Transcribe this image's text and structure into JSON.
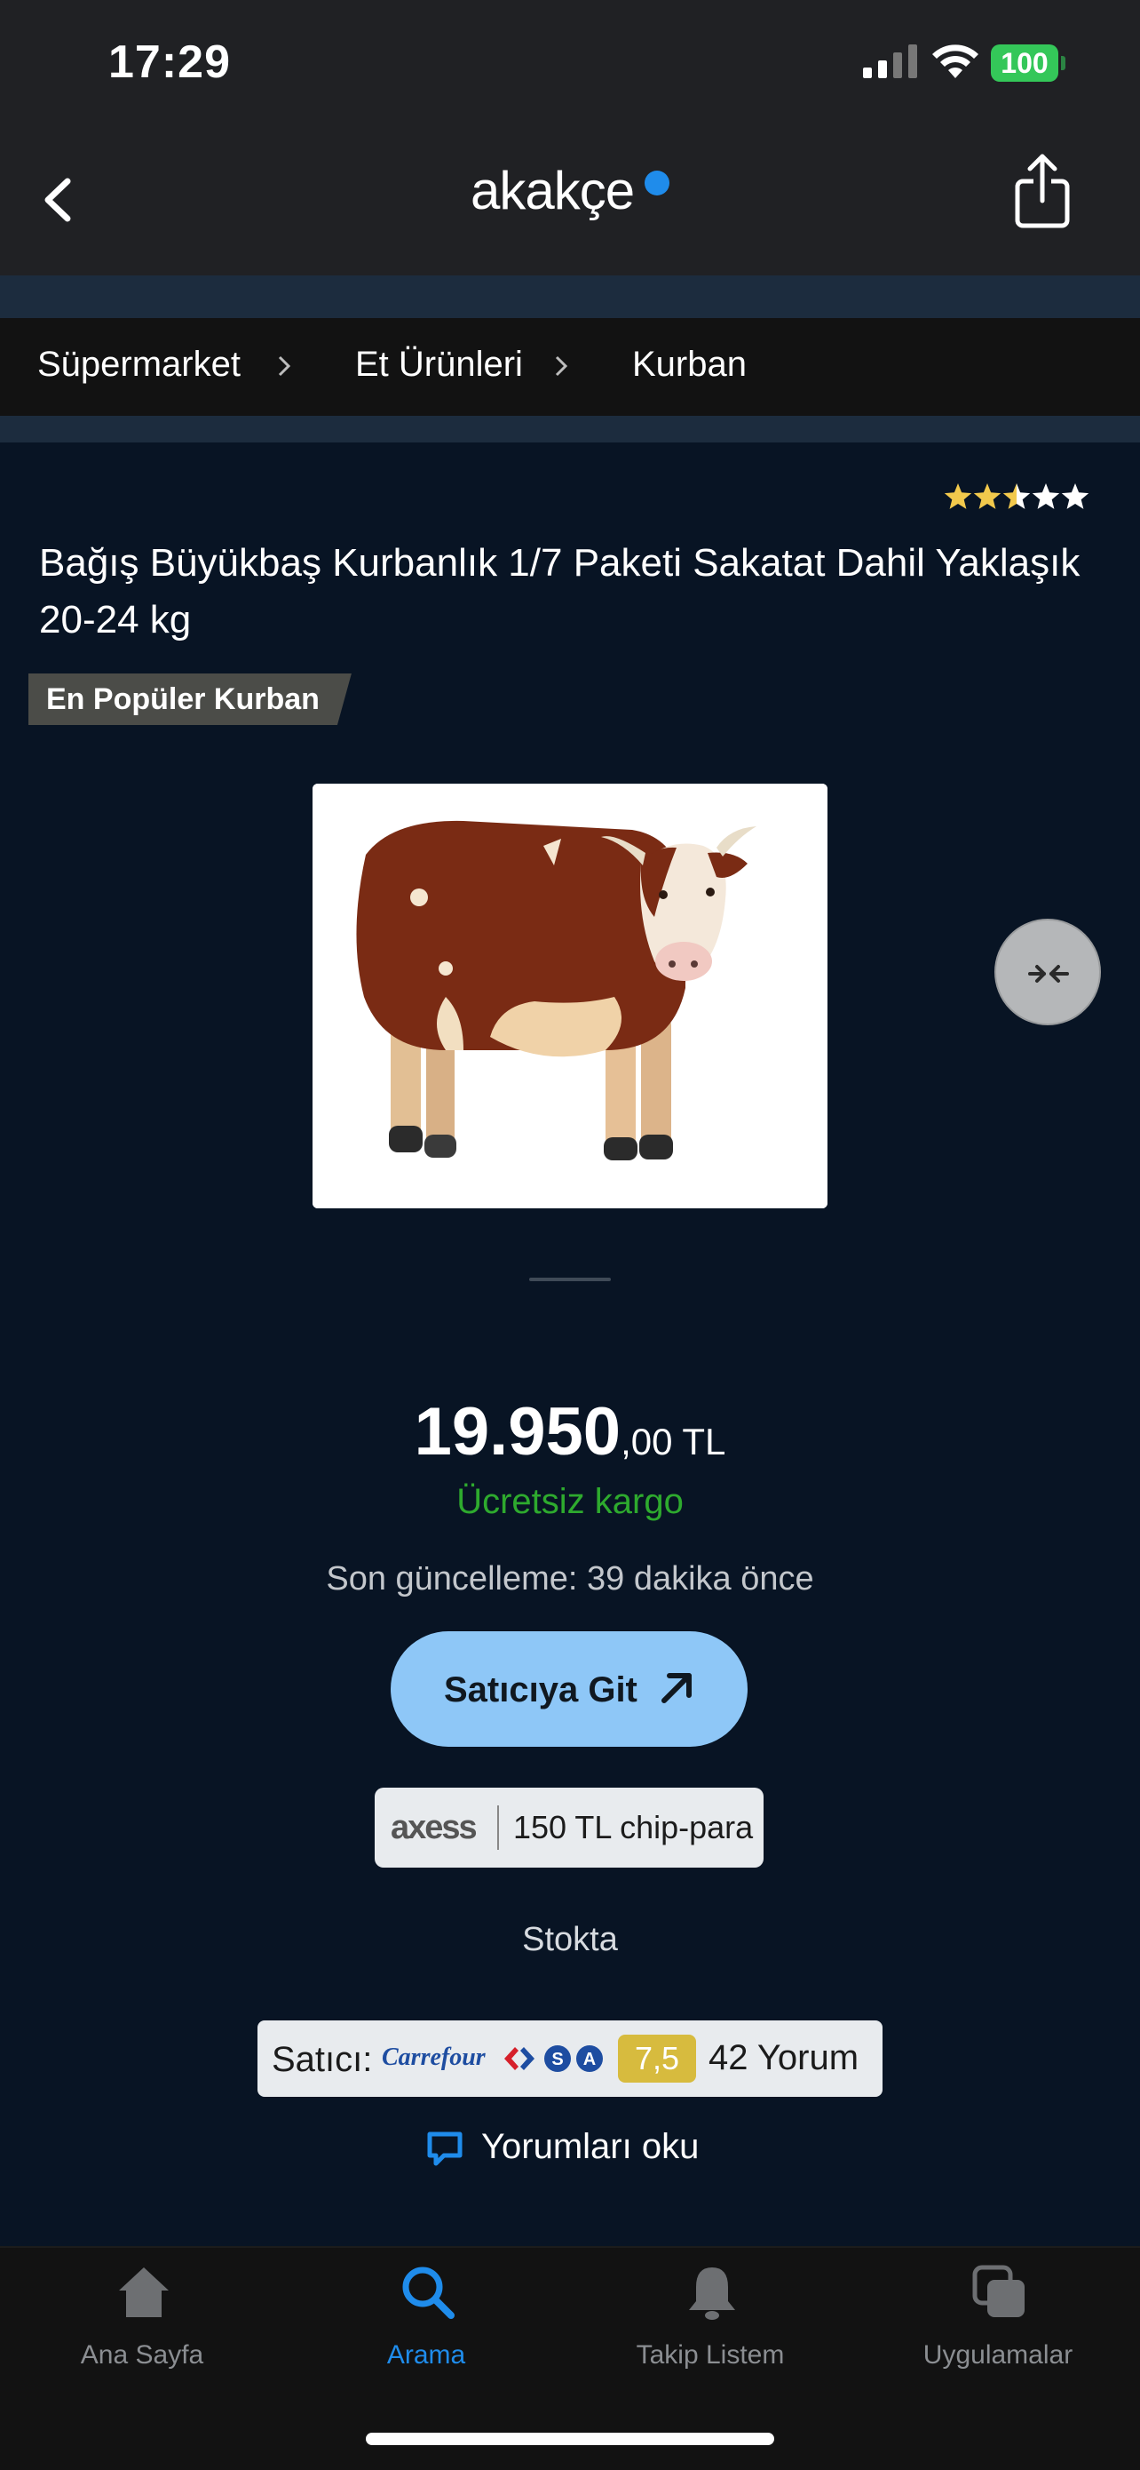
{
  "status_bar": {
    "time": "17:29",
    "battery": "100"
  },
  "nav": {
    "logo": "akakçe"
  },
  "breadcrumb": [
    {
      "label": "Süpermarket"
    },
    {
      "label": "Et Ürünleri"
    },
    {
      "label": "Kurban"
    }
  ],
  "product": {
    "rating_stars": 2.5,
    "rating_max": 5,
    "title": "Bağış Büyükbaş Kurbanlık 1/7 Paketi Sakatat Dahil Yaklaşık 20-24 kg",
    "badge": "En Popüler Kurban",
    "price_main": "19.950",
    "price_decimal": ",00 TL",
    "shipping": "Ücretsiz kargo",
    "last_update": "Son güncelleme: 39 dakika önce",
    "cta": "Satıcıya Git",
    "promo_brand": "axess",
    "promo_text": "150 TL chip-para",
    "stock": "Stokta"
  },
  "seller": {
    "label": "Satıcı:",
    "brand": "Carrefour",
    "score": "7,5",
    "reviews": "42 Yorum",
    "read_reviews": "Yorumları oku"
  },
  "tabbar": {
    "items": [
      {
        "label": "Ana Sayfa",
        "icon": "home-icon"
      },
      {
        "label": "Arama",
        "icon": "search-icon"
      },
      {
        "label": "Takip Listem",
        "icon": "bell-icon"
      },
      {
        "label": "Uygulamalar",
        "icon": "apps-icon"
      }
    ],
    "active_index": 1
  },
  "colors": {
    "background": "#081424",
    "accent": "#1f8ceb",
    "cta": "#8ec7f7",
    "shipping": "#2eaa2e",
    "score": "#d7bb3e"
  }
}
